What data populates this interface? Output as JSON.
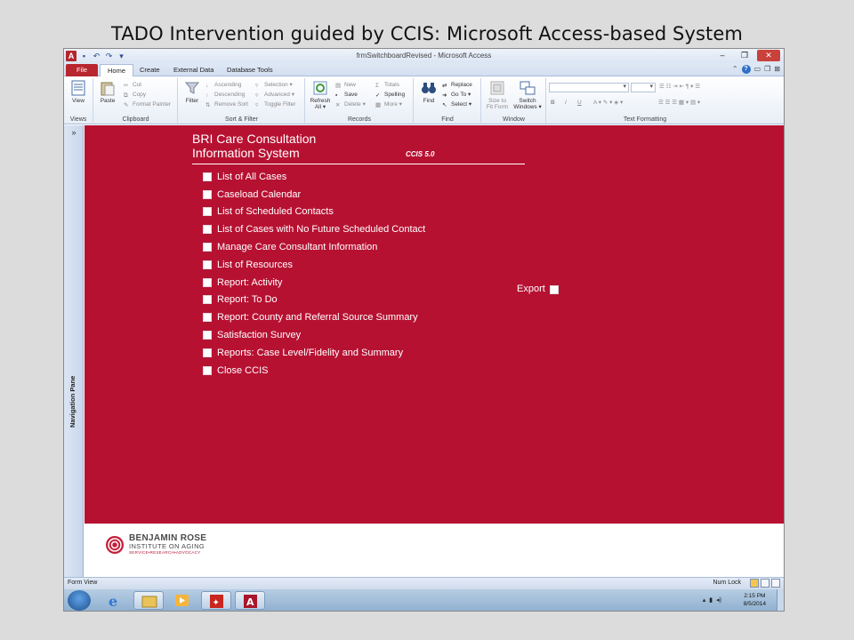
{
  "slide": {
    "title": "TADO Intervention guided by CCIS: Microsoft Access-based System"
  },
  "window": {
    "title": "frmSwitchboardRevised - Microsoft Access",
    "app_letter": "A"
  },
  "tabs": [
    "File",
    "Home",
    "Create",
    "External Data",
    "Database Tools"
  ],
  "active_tab": "Home",
  "ribbon": {
    "views": {
      "button": "View",
      "group": "Views"
    },
    "clipboard": {
      "paste": "Paste",
      "cut": "Cut",
      "copy": "Copy",
      "format_painter": "Format Painter",
      "group": "Clipboard"
    },
    "sort_filter": {
      "filter": "Filter",
      "ascending": "Ascending",
      "descending": "Descending",
      "remove_sort": "Remove Sort",
      "selection": "Selection",
      "advanced": "Advanced",
      "toggle_filter": "Toggle Filter",
      "group": "Sort & Filter"
    },
    "records": {
      "refresh": "Refresh",
      "refresh2": "All",
      "new": "New",
      "save": "Save",
      "delete": "Delete",
      "totals": "Totals",
      "spelling": "Spelling",
      "more": "More",
      "group": "Records"
    },
    "find": {
      "find": "Find",
      "replace": "Replace",
      "goto": "Go To",
      "select": "Select",
      "group": "Find"
    },
    "window": {
      "size_to_fit": "Size to",
      "size_to_fit2": "Fit Form",
      "switch": "Switch",
      "switch2": "Windows",
      "group": "Window"
    },
    "text_formatting": {
      "bold": "B",
      "italic": "I",
      "underline": "U",
      "font_color": "A",
      "group": "Text Formatting"
    }
  },
  "nav_pane": {
    "label": "Navigation Pane",
    "chevron": "»"
  },
  "form": {
    "header_line1": "BRI Care Consultation",
    "header_line2": "Information System",
    "version": "CCIS 5.0",
    "menu_items": [
      "List of All Cases",
      "Caseload Calendar",
      "List of Scheduled Contacts",
      "List of Cases with No Future Scheduled Contact",
      "Manage Care Consultant Information",
      "List of Resources",
      "Report: Activity",
      "Report: To Do",
      "Report: County and Referral Source Summary",
      "Satisfaction Survey",
      "Reports: Case Level/Fidelity and Summary",
      "Close CCIS"
    ],
    "export_label": "Export",
    "colors": {
      "background": "#b71132",
      "text": "#ffffff"
    }
  },
  "logo": {
    "line1": "BENJAMIN ROSE",
    "line2": "INSTITUTE ON AGING",
    "line3": "SERVICE•RESEARCH•ADVOCACY"
  },
  "statusbar": {
    "left": "Form View",
    "right": "Num Lock"
  },
  "taskbar": {
    "time": "2:15 PM",
    "date": "8/5/2014"
  }
}
